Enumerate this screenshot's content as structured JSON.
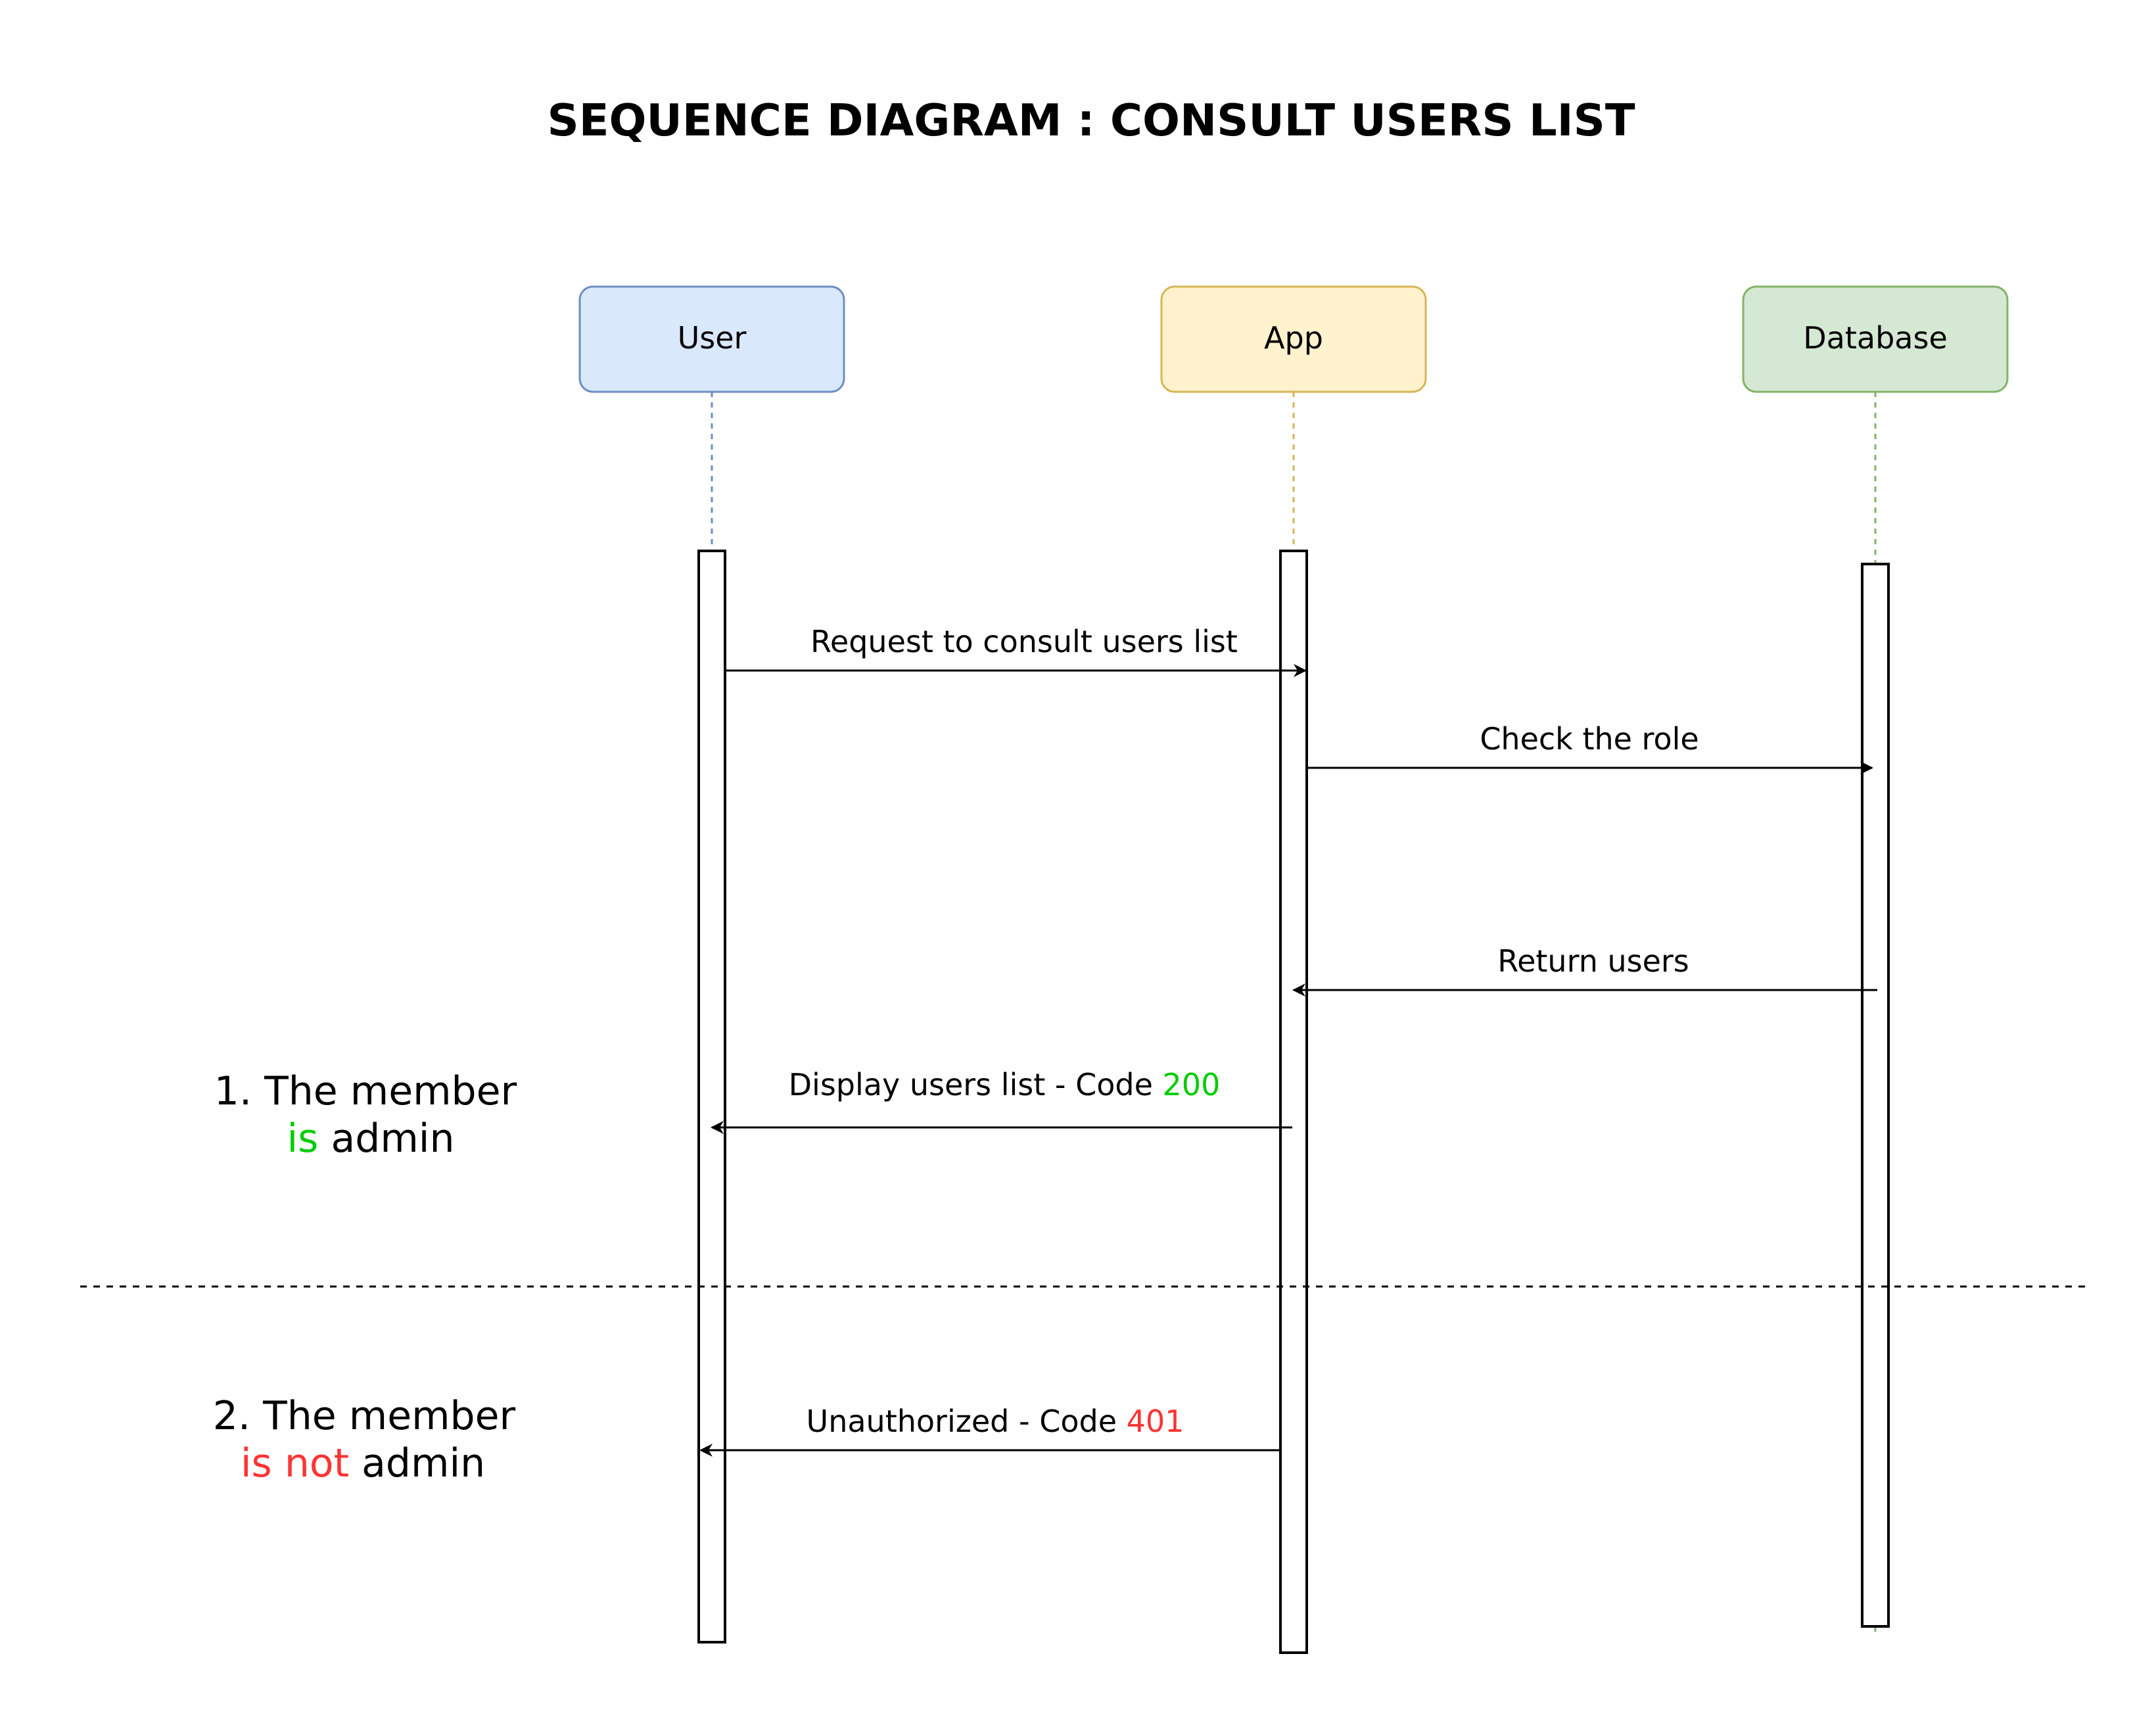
{
  "title": "SEQUENCE DIAGRAM : CONSULT USERS LIST",
  "actors": [
    {
      "id": "user",
      "label": "User",
      "fill": "#dae8fc",
      "stroke": "#6c8ebf"
    },
    {
      "id": "app",
      "label": "App",
      "fill": "#fff2cc",
      "stroke": "#d6b656"
    },
    {
      "id": "database",
      "label": "Database",
      "fill": "#d5e8d4",
      "stroke": "#82b366"
    }
  ],
  "messages": [
    {
      "id": "request",
      "from": "user",
      "to": "app",
      "text": "Request to consult users list",
      "code": "",
      "code_color": ""
    },
    {
      "id": "check-role",
      "from": "app",
      "to": "database",
      "text": "Check the role",
      "code": "",
      "code_color": ""
    },
    {
      "id": "return-users",
      "from": "database",
      "to": "app",
      "text": "Return users",
      "code": "",
      "code_color": ""
    },
    {
      "id": "display-users",
      "from": "app",
      "to": "user",
      "text": "Display users list - Code ",
      "code": "200",
      "code_color": "#00cc00"
    },
    {
      "id": "unauthorized",
      "from": "app",
      "to": "user",
      "text": "Unauthorized - Code ",
      "code": "401",
      "code_color": "#ff3333"
    }
  ],
  "notes": [
    {
      "id": "case-admin",
      "line1": "1. The member",
      "line2_highlight": "is",
      "line2_rest": " admin",
      "highlight_color": "#00cc00"
    },
    {
      "id": "case-not-admin",
      "line1": "2. The member",
      "line2_highlight": "is not",
      "line2_rest": " admin",
      "highlight_color": "#ff3333"
    }
  ]
}
